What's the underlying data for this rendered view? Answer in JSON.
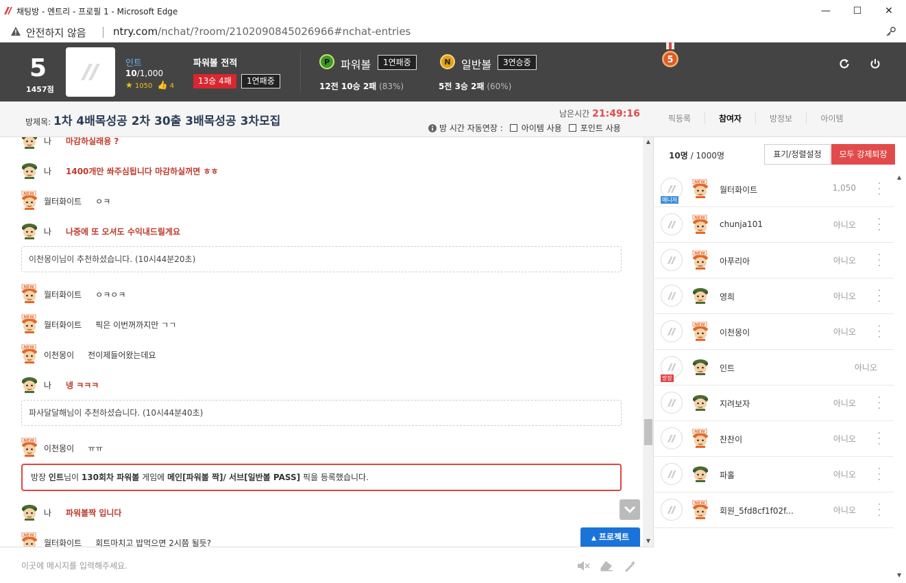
{
  "window": {
    "title": "채팅방 - 엔트리 - 프로필 1 - Microsoft Edge",
    "minimize": "—",
    "maximize": "☐",
    "close": "✕"
  },
  "address": {
    "security": "안전하지 않음",
    "url_host": "ntry.com",
    "url_path": "/nchat/?room/2102090845026966#nchat-entries"
  },
  "profile": {
    "level": "5",
    "points": "1457점",
    "name": "인트",
    "level_progress_bold": "10",
    "level_progress_rest": "/1,000",
    "stars": "1050",
    "likes": "4",
    "powerball_title": "파워볼 전적",
    "powerball_record": "13승 4패",
    "powerball_streak": "1연패중"
  },
  "games": [
    {
      "icon_letter": "P",
      "name": "파워볼",
      "streak": "1연패중",
      "stat_bold": "12전 10승 2패",
      "stat_pct": "(83%)",
      "color": "#3a9a2a"
    },
    {
      "icon_letter": "N",
      "name": "일반볼",
      "streak": "3연승중",
      "stat_bold": "5전 3승 2패",
      "stat_pct": "(60%)",
      "color": "#e3a216"
    }
  ],
  "medal_number": "5",
  "room": {
    "label": "방제목:",
    "title": "1차 4배목성공 2차 30출 3배목성공 3차모집",
    "remain_label": "남은시간",
    "remain_time": "21:49:16",
    "auto_extend": "방 시간 자동연장 :",
    "opt_item": "아이템 사용",
    "opt_point": "포인트 사용"
  },
  "tabs": [
    "픽등록",
    "참여자",
    "방정보",
    "아이템"
  ],
  "chat": {
    "messages": [
      {
        "sender": "나",
        "text": "마감하실래용 ?"
      },
      {
        "sender": "나",
        "text": "1400개만 쏴주심됩니다 마감하실꺼면 ㅎㅎ"
      },
      {
        "sender": "월터화이트",
        "text": "ㅇㅋ"
      },
      {
        "sender": "나",
        "text": "나중에 또 오셔도 수익내드릴게요"
      },
      {
        "sender": "월터화이트",
        "text": "ㅇㅋㅇㅋ"
      },
      {
        "sender": "월터화이트",
        "text": "픽은 이번꺼까지만 ㄱㄱ"
      },
      {
        "sender": "이천몽이",
        "text": "전이제들어왔는데요"
      },
      {
        "sender": "나",
        "text": "넹 ㅋㅋㅋ"
      },
      {
        "sender": "이천몽이",
        "text": "ㅠㅠ"
      },
      {
        "sender": "나",
        "text": "파워볼짝 입니다"
      },
      {
        "sender": "월터화이트",
        "text": "회트마치고 밥먹으면 2시쯤 될듯?"
      }
    ],
    "notices": [
      "이천몽이님이 추천하셨습니다. (10시44분20초)",
      "파사달달해님이 추천하셨습니다. (10시44분40초)"
    ],
    "pick": {
      "p1": "방장 ",
      "host": "인트",
      "p2": "님이 ",
      "round": "130회차 파워볼",
      "p3": " 게임에 ",
      "pick": "메인[파워볼 짝]/ 서브[일반볼 PASS]",
      "p4": " 픽을 등록했습니다."
    },
    "project_button": "프로젝트",
    "input_placeholder": "이곳에 메시지를 입력해주세요."
  },
  "participants": {
    "count_bold": "10명",
    "count_rest": " / 1000명",
    "sort_button": "표기/정렬설정",
    "kick_button": "모두 강제퇴장",
    "rows": [
      {
        "name": "월터화이트",
        "value": "1,050",
        "badge": "매니저",
        "badge_color": "#3d8fd6",
        "char": "new"
      },
      {
        "name": "chunja101",
        "value": "아니오",
        "badge": "",
        "char": "new"
      },
      {
        "name": "아푸리아",
        "value": "아니오",
        "badge": "",
        "char": "new"
      },
      {
        "name": "영희",
        "value": "아니오",
        "badge": "",
        "char": "soldier"
      },
      {
        "name": "이천몽이",
        "value": "아니오",
        "badge": "",
        "char": "new"
      },
      {
        "name": "인트",
        "value": "아니오",
        "badge": "방장",
        "badge_color": "#e04343",
        "char": "soldier"
      },
      {
        "name": "지려보자",
        "value": "아니오",
        "badge": "",
        "char": "soldier"
      },
      {
        "name": "찬찬이",
        "value": "아니오",
        "badge": "",
        "char": "new"
      },
      {
        "name": "파홀",
        "value": "아니오",
        "badge": "",
        "char": "soldier"
      },
      {
        "name": "회원_5fd8cf1f02f...",
        "value": "아니오",
        "badge": "",
        "char": "new"
      }
    ]
  }
}
